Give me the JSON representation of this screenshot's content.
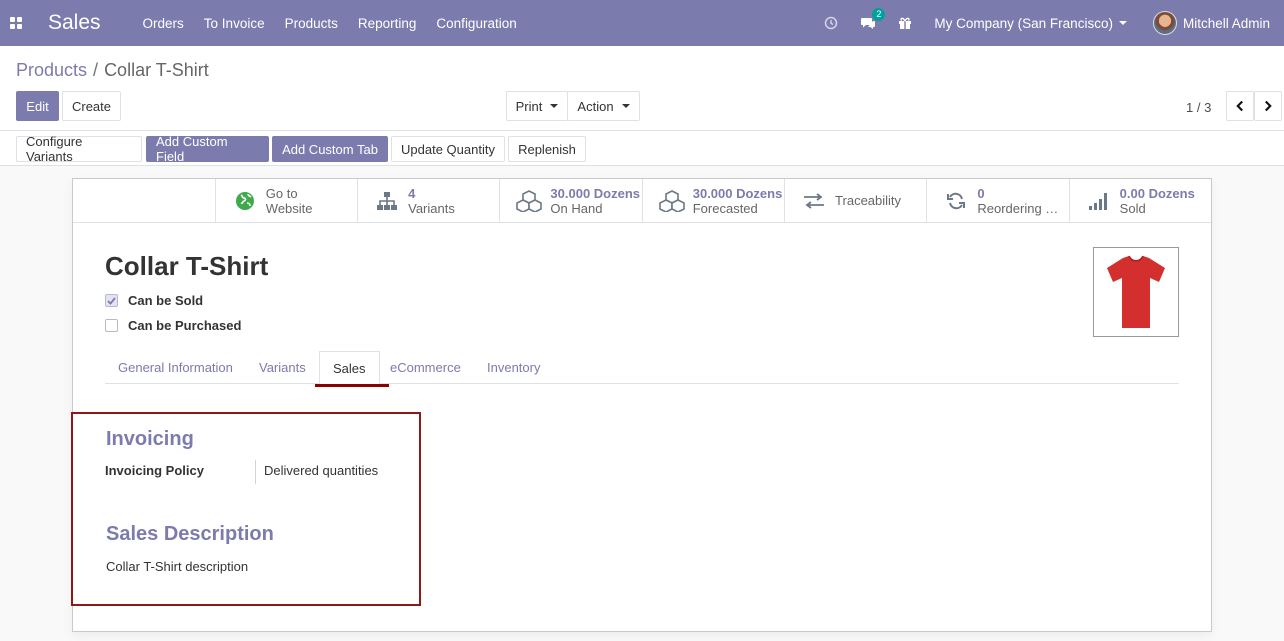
{
  "navbar": {
    "app_name": "Sales",
    "menu": [
      "Orders",
      "To Invoice",
      "Products",
      "Reporting",
      "Configuration"
    ],
    "messages_badge": "2",
    "company": "My Company (San Francisco)",
    "user": "Mitchell Admin",
    "background_color": "#7c7bad"
  },
  "breadcrumb": {
    "parent": "Products",
    "separator": "/",
    "current": "Collar T-Shirt"
  },
  "toolbar": {
    "edit": "Edit",
    "create": "Create",
    "print": "Print",
    "action": "Action",
    "pager": "1 / 3"
  },
  "header_buttons": {
    "configure_variants": "Configure Variants",
    "add_custom_field": "Add Custom Field",
    "add_custom_tab": "Add Custom Tab",
    "update_quantity": "Update Quantity",
    "replenish": "Replenish"
  },
  "smart_buttons": {
    "website": {
      "line1": "Go to",
      "line2": "Website",
      "icon": "globe-icon"
    },
    "variants": {
      "value": "4",
      "label": "Variants",
      "icon": "sitemap-icon"
    },
    "on_hand": {
      "value": "30.000 Dozens",
      "label": "On Hand",
      "icon": "cubes-icon"
    },
    "forecasted": {
      "value": "30.000 Dozens",
      "label": "Forecasted",
      "icon": "cubes-icon"
    },
    "traceability": {
      "label": "Traceability",
      "icon": "exchange-icon"
    },
    "reordering": {
      "value": "0",
      "label": "Reordering Rules",
      "icon": "refresh-icon"
    },
    "sold": {
      "value": "0.00 Dozens",
      "label": "Sold",
      "icon": "signal-icon"
    }
  },
  "product": {
    "name": "Collar T-Shirt",
    "can_be_sold": {
      "label": "Can be Sold",
      "checked": true
    },
    "can_be_purchased": {
      "label": "Can be Purchased",
      "checked": false
    },
    "image_color": "#d32f2f"
  },
  "tabs": [
    "General Information",
    "Variants",
    "Sales",
    "eCommerce",
    "Inventory"
  ],
  "active_tab": "Sales",
  "sales_tab": {
    "invoicing_title": "Invoicing",
    "invoicing_policy_label": "Invoicing Policy",
    "invoicing_policy_value": "Delivered quantities",
    "sales_description_title": "Sales Description",
    "sales_description": "Collar T-Shirt description"
  }
}
